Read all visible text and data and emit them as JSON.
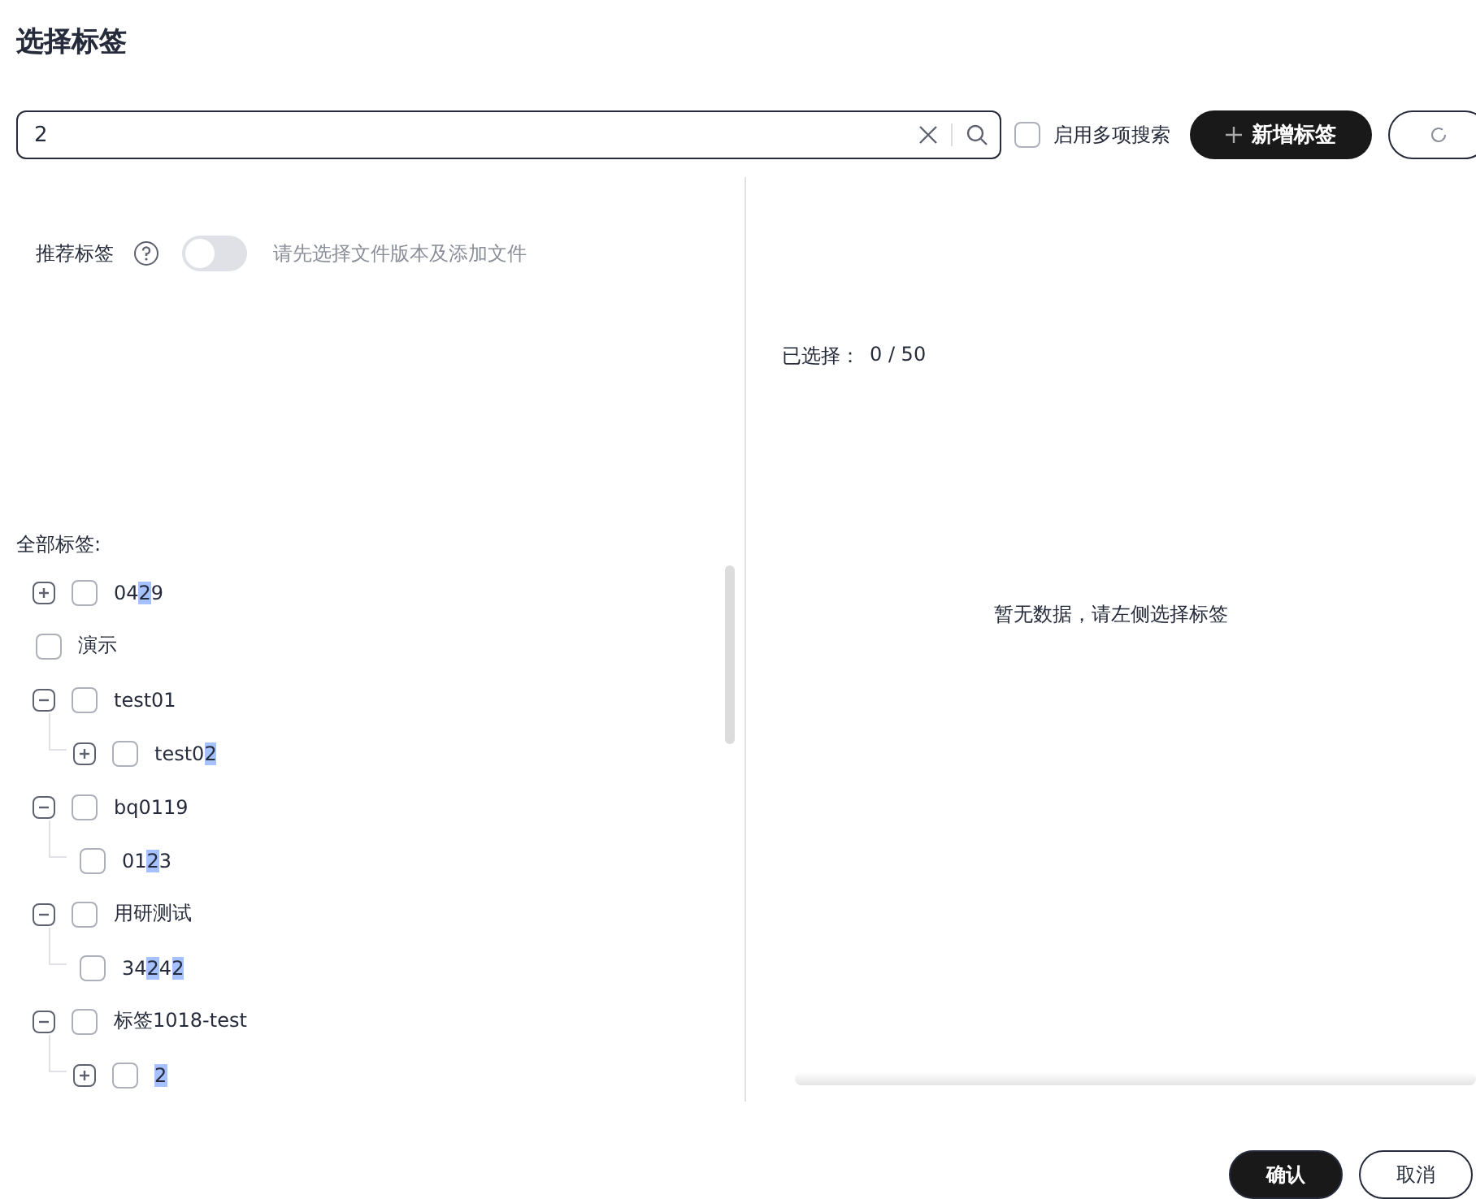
{
  "title": "选择标签",
  "search": {
    "value": "2",
    "multi_search": {
      "label": "启用多项搜索",
      "checked": false
    },
    "add_button": "新增标签"
  },
  "recommend": {
    "label": "推荐标签",
    "on": false,
    "hint": "请先选择文件版本及添加文件"
  },
  "all_tags": {
    "label": "全部标签:",
    "tree": [
      {
        "segments": [
          {
            "text": "04",
            "match": false
          },
          {
            "text": "2",
            "match": true
          },
          {
            "text": "9",
            "match": false
          }
        ],
        "checked": false,
        "expanded": false
      },
      {
        "segments": [
          {
            "text": "演示",
            "match": false
          }
        ],
        "checked": false
      },
      {
        "segments": [
          {
            "text": "test01",
            "match": false
          }
        ],
        "checked": false,
        "expanded": true,
        "children": [
          {
            "segments": [
              {
                "text": "test0",
                "match": false
              },
              {
                "text": "2",
                "match": true
              }
            ],
            "checked": false,
            "expanded": false
          }
        ]
      },
      {
        "segments": [
          {
            "text": "bq0119",
            "match": false
          }
        ],
        "checked": false,
        "expanded": true,
        "children": [
          {
            "segments": [
              {
                "text": "01",
                "match": false
              },
              {
                "text": "2",
                "match": true
              },
              {
                "text": "3",
                "match": false
              }
            ],
            "checked": false
          }
        ]
      },
      {
        "segments": [
          {
            "text": "用研测试",
            "match": false
          }
        ],
        "checked": false,
        "expanded": true,
        "children": [
          {
            "segments": [
              {
                "text": "34",
                "match": false
              },
              {
                "text": "2",
                "match": true
              },
              {
                "text": "4",
                "match": false
              },
              {
                "text": "2",
                "match": true
              }
            ],
            "checked": false
          }
        ]
      },
      {
        "segments": [
          {
            "text": "标签1018-test",
            "match": false
          }
        ],
        "checked": false,
        "expanded": true,
        "children": [
          {
            "segments": [
              {
                "text": "2",
                "match": true
              }
            ],
            "checked": false,
            "expanded": false
          }
        ]
      }
    ]
  },
  "selected": {
    "label": "已选择：",
    "count": "0 / 50",
    "empty": "暂无数据，请左侧选择标签"
  },
  "footer": {
    "confirm": "确认",
    "cancel": "取消"
  }
}
